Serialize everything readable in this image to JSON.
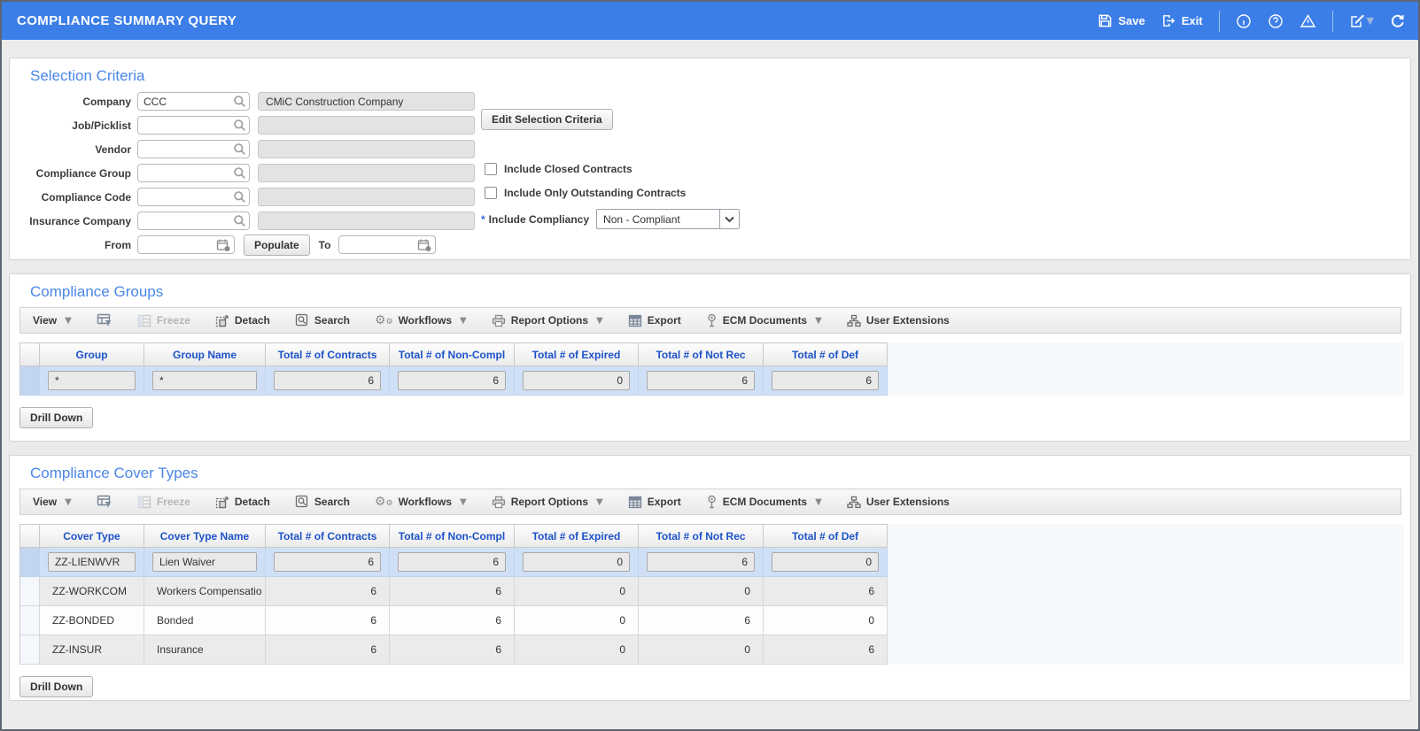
{
  "header": {
    "title": "COMPLIANCE SUMMARY QUERY",
    "save_label": "Save",
    "exit_label": "Exit"
  },
  "selection_criteria": {
    "title": "Selection Criteria",
    "fields": [
      {
        "label": "Company",
        "value": "CCC",
        "desc": "CMiC Construction Company"
      },
      {
        "label": "Job/Picklist",
        "value": "",
        "desc": ""
      },
      {
        "label": "Vendor",
        "value": "",
        "desc": ""
      },
      {
        "label": "Compliance Group",
        "value": "",
        "desc": ""
      },
      {
        "label": "Compliance Code",
        "value": "",
        "desc": ""
      },
      {
        "label": "Insurance Company",
        "value": "",
        "desc": ""
      }
    ],
    "edit_button": "Edit Selection Criteria",
    "checkboxes": [
      {
        "label": "Include Closed Contracts",
        "checked": false
      },
      {
        "label": "Include Only Outstanding Contracts",
        "checked": false
      }
    ],
    "compliancy": {
      "required_marker": "*",
      "label": "Include Compliancy",
      "value": "Non - Compliant"
    },
    "from_label": "From",
    "from_value": "",
    "populate_button": "Populate",
    "to_label": "To",
    "to_value": ""
  },
  "toolbar": {
    "view": "View",
    "freeze": "Freeze",
    "detach": "Detach",
    "search": "Search",
    "workflows": "Workflows",
    "report_options": "Report Options",
    "export": "Export",
    "ecm_documents": "ECM Documents",
    "user_extensions": "User Extensions"
  },
  "groups_section": {
    "title": "Compliance Groups",
    "columns": [
      "Group",
      "Group Name",
      "Total # of Contracts",
      "Total # of Non-Compl",
      "Total # of Expired",
      "Total # of Not Rec",
      "Total # of Def"
    ],
    "rows": [
      [
        "*",
        "*",
        "6",
        "6",
        "0",
        "6",
        "6"
      ]
    ],
    "drill_down": "Drill Down"
  },
  "cover_types_section": {
    "title": "Compliance Cover Types",
    "columns": [
      "Cover Type",
      "Cover Type Name",
      "Total # of Contracts",
      "Total # of Non-Compl",
      "Total # of Expired",
      "Total # of Not Rec",
      "Total # of Def"
    ],
    "rows": [
      [
        "ZZ-LIENWVR",
        "Lien Waiver",
        "6",
        "6",
        "0",
        "6",
        "0"
      ],
      [
        "ZZ-WORKCOM",
        "Workers Compensatio",
        "6",
        "6",
        "0",
        "0",
        "6"
      ],
      [
        "ZZ-BONDED",
        "Bonded",
        "6",
        "6",
        "0",
        "6",
        "0"
      ],
      [
        "ZZ-INSUR",
        "Insurance",
        "6",
        "6",
        "0",
        "0",
        "6"
      ]
    ],
    "drill_down": "Drill Down"
  },
  "icons": {
    "save": "floppy-disk",
    "exit": "exit-arrow",
    "info": "info-circle",
    "help": "question-circle",
    "warning": "warning-triangle",
    "edit": "edit-note",
    "dropdown": "chevron-down",
    "refresh": "refresh-circular-arrow",
    "lov": "magnifier",
    "date": "calendar-clock",
    "qbe": "query-by-example-filter",
    "freeze": "freeze-grid",
    "detach": "detach-window",
    "search": "search-page",
    "workflows": "gears",
    "report_options": "printer",
    "export": "export-table",
    "ecm_documents": "pin",
    "user_extensions": "org-chart"
  },
  "colors": {
    "titlebar": "#3C7EE8",
    "section_title": "#4A87E8",
    "table_header_text": "#1D53C9",
    "selected_row": "#CFE0F6",
    "readonly_field": "#E3E3E3",
    "required_marker": "#2F6FE4"
  }
}
